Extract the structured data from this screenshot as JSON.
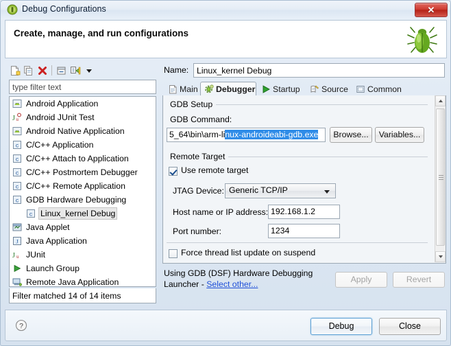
{
  "window": {
    "title": "Debug Configurations",
    "title_icon": "eclipse-debug-icon",
    "close_label": "✕"
  },
  "header": {
    "title": "Create, manage, and run configurations",
    "banner_icon": "green-bug-icon"
  },
  "left_panel": {
    "toolbar": [
      {
        "name": "new-launch-configuration-icon",
        "label": "New"
      },
      {
        "name": "duplicate-configuration-icon",
        "label": "Duplicate"
      },
      {
        "name": "delete-configuration-icon",
        "label": "Delete"
      },
      {
        "name": "collapse-all-icon",
        "label": "Collapse All"
      },
      {
        "name": "filter-configurations-icon",
        "label": "Filter"
      },
      {
        "name": "view-menu-chevron-down-icon",
        "label": "View Menu"
      }
    ],
    "filter": {
      "value": "type filter text",
      "placeholder": "type filter text"
    },
    "tree": [
      {
        "label": "Android Application",
        "icon": "android-application-icon",
        "indent": 0,
        "arrow": "none",
        "selected": false
      },
      {
        "label": "Android JUnit Test",
        "icon": "android-junit-icon",
        "indent": 0,
        "arrow": "none",
        "selected": false
      },
      {
        "label": "Android Native Application",
        "icon": "android-application-icon",
        "indent": 0,
        "arrow": "none",
        "selected": false
      },
      {
        "label": "C/C++ Application",
        "icon": "c-cpp-icon",
        "indent": 0,
        "arrow": "none",
        "selected": false
      },
      {
        "label": "C/C++ Attach to Application",
        "icon": "c-cpp-icon",
        "indent": 0,
        "arrow": "none",
        "selected": false
      },
      {
        "label": "C/C++ Postmortem Debugger",
        "icon": "c-cpp-icon",
        "indent": 0,
        "arrow": "none",
        "selected": false
      },
      {
        "label": "C/C++ Remote Application",
        "icon": "c-cpp-icon",
        "indent": 0,
        "arrow": "none",
        "selected": false
      },
      {
        "label": "GDB Hardware Debugging",
        "icon": "c-cpp-icon",
        "indent": 0,
        "arrow": "expanded",
        "selected": false
      },
      {
        "label": "Linux_kernel Debug",
        "icon": "c-cpp-icon",
        "indent": 1,
        "arrow": "none",
        "selected": true
      },
      {
        "label": "Java Applet",
        "icon": "java-applet-icon",
        "indent": 0,
        "arrow": "none",
        "selected": false
      },
      {
        "label": "Java Application",
        "icon": "java-application-icon",
        "indent": 0,
        "arrow": "none",
        "selected": false
      },
      {
        "label": "JUnit",
        "icon": "junit-icon",
        "indent": 0,
        "arrow": "none",
        "selected": false
      },
      {
        "label": "Launch Group",
        "icon": "launch-group-icon",
        "indent": 0,
        "arrow": "none",
        "selected": false
      },
      {
        "label": "Remote Java Application",
        "icon": "remote-java-application-icon",
        "indent": 0,
        "arrow": "none",
        "selected": false
      }
    ],
    "filter_status": "Filter matched 14 of 14 items"
  },
  "right_panel": {
    "name_label": "Name:",
    "name_value": "Linux_kernel Debug",
    "tabs": [
      {
        "label": "Main",
        "icon": "document-icon",
        "active": false
      },
      {
        "label": "Debugger",
        "icon": "bug-gear-icon",
        "active": true
      },
      {
        "label": "Startup",
        "icon": "green-play-icon",
        "active": false
      },
      {
        "label": "Source",
        "icon": "source-lookup-icon",
        "active": false
      },
      {
        "label": "Common",
        "icon": "common-square-icon",
        "active": false
      }
    ],
    "gdb_setup": {
      "group_title": "GDB Setup",
      "command_label": "GDB Command:",
      "command_value_plain": "5_64\\bin\\arm-li",
      "command_value_selected": "nux-androideabi-gdb.exe",
      "browse_label": "Browse...",
      "variables_label": "Variables..."
    },
    "remote_target": {
      "group_title": "Remote Target",
      "use_remote_label": "Use remote target",
      "use_remote_checked": true,
      "jtag_label": "JTAG Device:",
      "jtag_value": "Generic TCP/IP",
      "host_label": "Host name or IP address:",
      "host_value": "192.168.1.2",
      "port_label": "Port number:",
      "port_value": "1234"
    },
    "force_thread": {
      "label": "Force thread list update on suspend",
      "checked": false
    },
    "launcher": {
      "text_line1": "Using GDB (DSF) Hardware Debugging",
      "text_line2_prefix": "Launcher - ",
      "link": "Select other...",
      "apply_label": "Apply",
      "revert_label": "Revert",
      "apply_enabled": false,
      "revert_enabled": false
    }
  },
  "footer": {
    "help_icon": "question-mark-help-icon",
    "debug_label": "Debug",
    "close_label": "Close"
  },
  "colors": {
    "selection_blue": "#2f8ce8",
    "link_blue": "#1f4fd8",
    "accent_border": "#5a9fd4",
    "close_red": "#cf3c31"
  }
}
